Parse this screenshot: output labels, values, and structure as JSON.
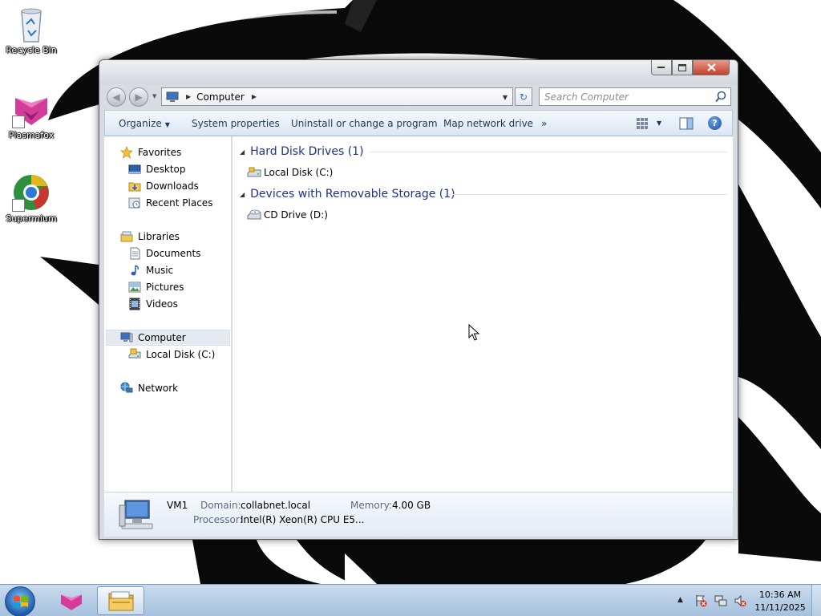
{
  "desktop": {
    "icons": [
      {
        "label": "Recycle Bin",
        "icon": "recycle-bin-icon"
      },
      {
        "label": "Plasmafox",
        "icon": "plasmafox-icon"
      },
      {
        "label": "Supermium",
        "icon": "supermium-icon"
      }
    ]
  },
  "window": {
    "title": "",
    "controls": {
      "minimize": "minimize-icon",
      "maximize": "maximize-icon",
      "close": "close-icon"
    },
    "address": {
      "crumbs": [
        "Computer"
      ]
    },
    "search": {
      "placeholder": "Search Computer"
    },
    "toolbar": {
      "organize": "Organize",
      "system_properties": "System properties",
      "uninstall": "Uninstall or change a program",
      "map_drive": "Map network drive",
      "more": "»"
    },
    "nav": {
      "favorites": "Favorites",
      "desktop": "Desktop",
      "downloads": "Downloads",
      "recent_places": "Recent Places",
      "libraries": "Libraries",
      "documents": "Documents",
      "music": "Music",
      "pictures": "Pictures",
      "videos": "Videos",
      "computer": "Computer",
      "local_disk": "Local Disk (C:)",
      "network": "Network"
    },
    "content": {
      "groups": [
        {
          "title": "Hard Disk Drives (1)",
          "items": [
            "Local Disk (C:)"
          ]
        },
        {
          "title": "Devices with Removable Storage (1)",
          "items": [
            "CD Drive (D:)"
          ]
        }
      ]
    },
    "details": {
      "name": "VM1",
      "domain_label": "Domain:",
      "domain_value": "collabnet.local",
      "memory_label": "Memory:",
      "memory_value": "4.00 GB",
      "processor_label": "Processor:",
      "processor_value": "Intel(R) Xeon(R) CPU E5..."
    }
  },
  "taskbar": {
    "clock": {
      "time": "10:36 AM",
      "date": "11/11/2025"
    },
    "pinned": [
      "plasmafox-icon",
      "windows-explorer-icon"
    ],
    "tray": [
      "action-center-icon",
      "network-icon",
      "volume-muted-icon"
    ]
  },
  "colors": {
    "group_header": "#1e3287",
    "command_text": "#1e395b",
    "close_button": "#c6412b",
    "taskbar": "#b8cee6"
  }
}
